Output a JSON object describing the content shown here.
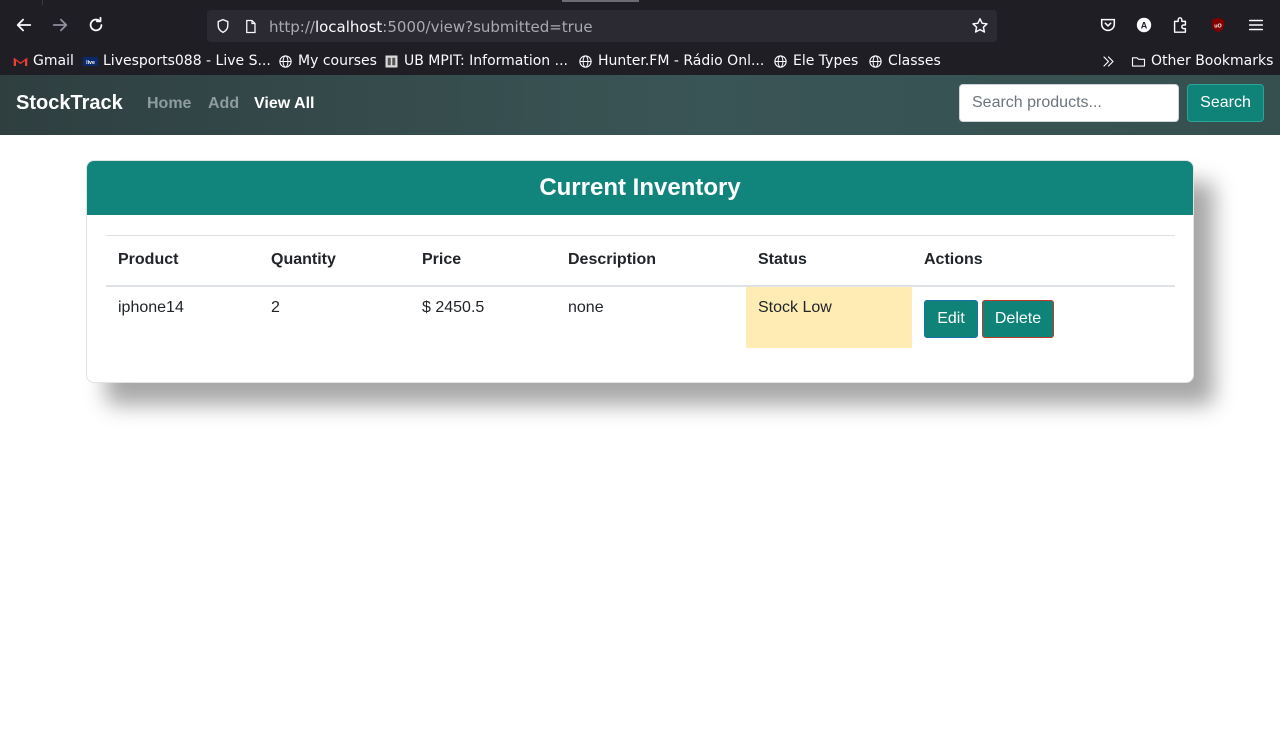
{
  "browser": {
    "url_prefix": "http://",
    "url_host": "localhost",
    "url_rest": ":5000/view?submitted=true",
    "bookmarks": [
      {
        "label": "Gmail",
        "icon": "gmail-icon"
      },
      {
        "label": "Livesports088 - Live S...",
        "icon": "livesports-icon"
      },
      {
        "label": "My courses",
        "icon": "globe-icon"
      },
      {
        "label": "UB MPIT: Information ...",
        "icon": "ub-icon"
      },
      {
        "label": "Hunter.FM - Rádio Onl...",
        "icon": "globe-icon"
      },
      {
        "label": "Ele Types",
        "icon": "globe-icon"
      },
      {
        "label": "Classes",
        "icon": "globe-icon"
      }
    ],
    "other_bookmarks": "Other Bookmarks"
  },
  "nav": {
    "brand": "StockTrack",
    "links": [
      "Home",
      "Add",
      "View All"
    ],
    "active": "View All",
    "search_placeholder": "Search products...",
    "search_button": "Search"
  },
  "inventory": {
    "title": "Current Inventory",
    "headers": [
      "Product",
      "Quantity",
      "Price",
      "Description",
      "Status",
      "Actions"
    ],
    "rows": [
      {
        "product": "iphone14",
        "quantity": "2",
        "price": "$ 2450.5",
        "description": "none",
        "status": "Stock Low"
      }
    ],
    "edit_label": "Edit",
    "delete_label": "Delete"
  },
  "colors": {
    "accent": "#11857b",
    "status_low_bg": "#ffecb5",
    "navbar_bg": "#34494a"
  }
}
